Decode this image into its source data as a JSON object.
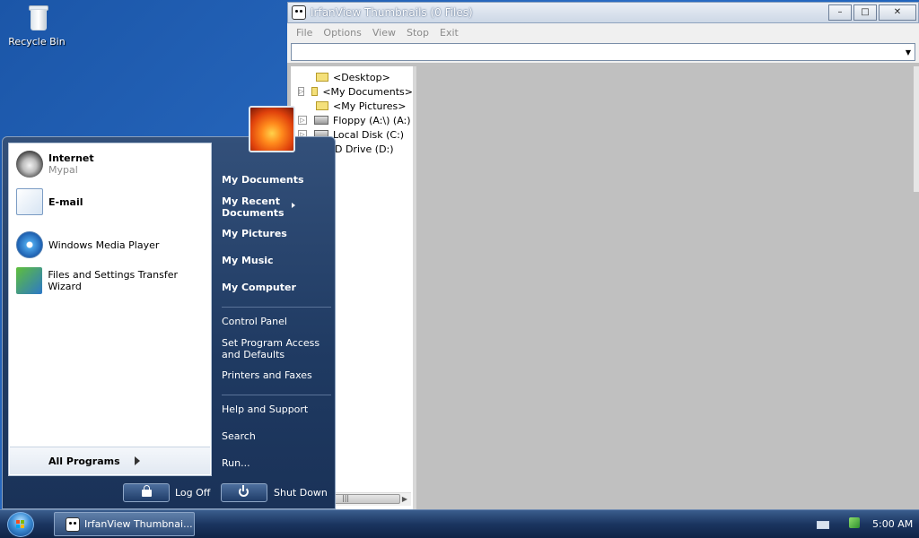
{
  "desktop": {
    "icons": [
      {
        "label": "Recycle Bin",
        "icon": "recycle-bin-icon"
      }
    ]
  },
  "window": {
    "title": "IrfanView Thumbnails (0 Files)",
    "controls": {
      "minimize": "–",
      "maximize": "□",
      "close": "✕"
    },
    "menu": [
      "File",
      "Options",
      "View",
      "Stop",
      "Exit"
    ],
    "address_value": "",
    "tree": [
      {
        "label": "<Desktop>",
        "icon": "folder-icon",
        "expander": false
      },
      {
        "label": "<My Documents>",
        "icon": "folder-icon",
        "expander": true
      },
      {
        "label": "<My Pictures>",
        "icon": "folder-icon",
        "expander": false
      },
      {
        "label": "Floppy (A:\\) (A:)",
        "icon": "floppy-drive-icon",
        "expander": true
      },
      {
        "label": "Local Disk (C:)",
        "icon": "hard-drive-icon",
        "expander": true
      },
      {
        "label": "D Drive (D:)",
        "icon": "cd-drive-icon",
        "expander": false
      }
    ],
    "scrollbar_grip": "|||"
  },
  "start_menu": {
    "pinned": [
      {
        "title": "Internet",
        "subtitle": "Mypal",
        "icon": "raccoon-browser-icon"
      },
      {
        "title": "E-mail",
        "subtitle": "",
        "icon": "envelope-icon"
      }
    ],
    "recent": [
      {
        "title": "Windows Media Player",
        "icon": "media-player-icon"
      },
      {
        "title": "Files and Settings Transfer Wizard",
        "icon": "transfer-wizard-icon"
      }
    ],
    "all_programs": "All Programs",
    "places": [
      {
        "label": "My Documents"
      },
      {
        "label": "My Recent Documents",
        "submenu": true
      },
      {
        "label": "My Pictures"
      },
      {
        "label": "My Music"
      },
      {
        "label": "My Computer"
      }
    ],
    "system": [
      {
        "label": "Control Panel"
      },
      {
        "label": "Set Program Access and Defaults"
      },
      {
        "label": "Printers and Faxes"
      }
    ],
    "help": [
      {
        "label": "Help and Support"
      },
      {
        "label": "Search"
      },
      {
        "label": "Run..."
      }
    ],
    "log_off": "Log Off",
    "shut_down": "Shut Down"
  },
  "taskbar": {
    "task": "IrfanView Thumbnai...",
    "clock": "5:00 AM"
  },
  "colors": {
    "desktop": "#1f5fb4",
    "taskbar": "#1b3560",
    "start_menu_right": "#1f3a62"
  }
}
